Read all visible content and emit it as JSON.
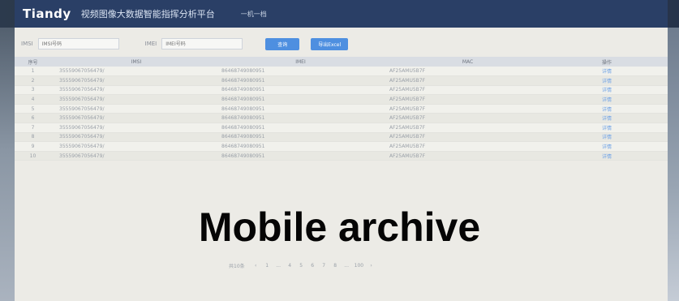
{
  "header": {
    "logo": "Tiandy",
    "platform_title": "视频图像大数据智能指挥分析平台",
    "user_label": "一机一档"
  },
  "filter": {
    "imsi_label": "IMSI",
    "imsi_placeholder": "IMSI号码",
    "imei_label": "IMEI",
    "imei_placeholder": "IMEI号码",
    "search_label": "查询",
    "import_label": "导出Excel"
  },
  "table": {
    "columns": [
      "序号",
      "IMSI",
      "IMEI",
      "MAC",
      "操作"
    ],
    "rows": [
      [
        "1",
        "35559067056479/",
        "86468749080951",
        "AF25AMU5B7F",
        "详情"
      ],
      [
        "2",
        "35559067056479/",
        "86468749080951",
        "AF25AMU5B7F",
        "详情"
      ],
      [
        "3",
        "35559067056479/",
        "86468749080951",
        "AF25AMU5B7F",
        "详情"
      ],
      [
        "4",
        "35559067056479/",
        "86468749080951",
        "AF25AMU5B7F",
        "详情"
      ],
      [
        "5",
        "35559067056479/",
        "86468749080951",
        "AF25AMU5B7F",
        "详情"
      ],
      [
        "6",
        "35559067056479/",
        "86468749080951",
        "AF25AMU5B7F",
        "详情"
      ],
      [
        "7",
        "35559067056479/",
        "86468749080951",
        "AF25AMU5B7F",
        "详情"
      ],
      [
        "8",
        "35559067056479/",
        "86468749080951",
        "AF25AMU5B7F",
        "详情"
      ],
      [
        "9",
        "35559067056479/",
        "86468749080951",
        "AF25AMU5B7F",
        "详情"
      ],
      [
        "10",
        "35559067056479/",
        "86468749080951",
        "AF25AMU5B7F",
        "详情"
      ]
    ]
  },
  "overlay_title": "Mobile archive",
  "pager": {
    "total": "共10条",
    "items": [
      "‹",
      "1",
      "...",
      "4",
      "5",
      "6",
      "7",
      "8",
      "...",
      "100",
      "›"
    ]
  }
}
